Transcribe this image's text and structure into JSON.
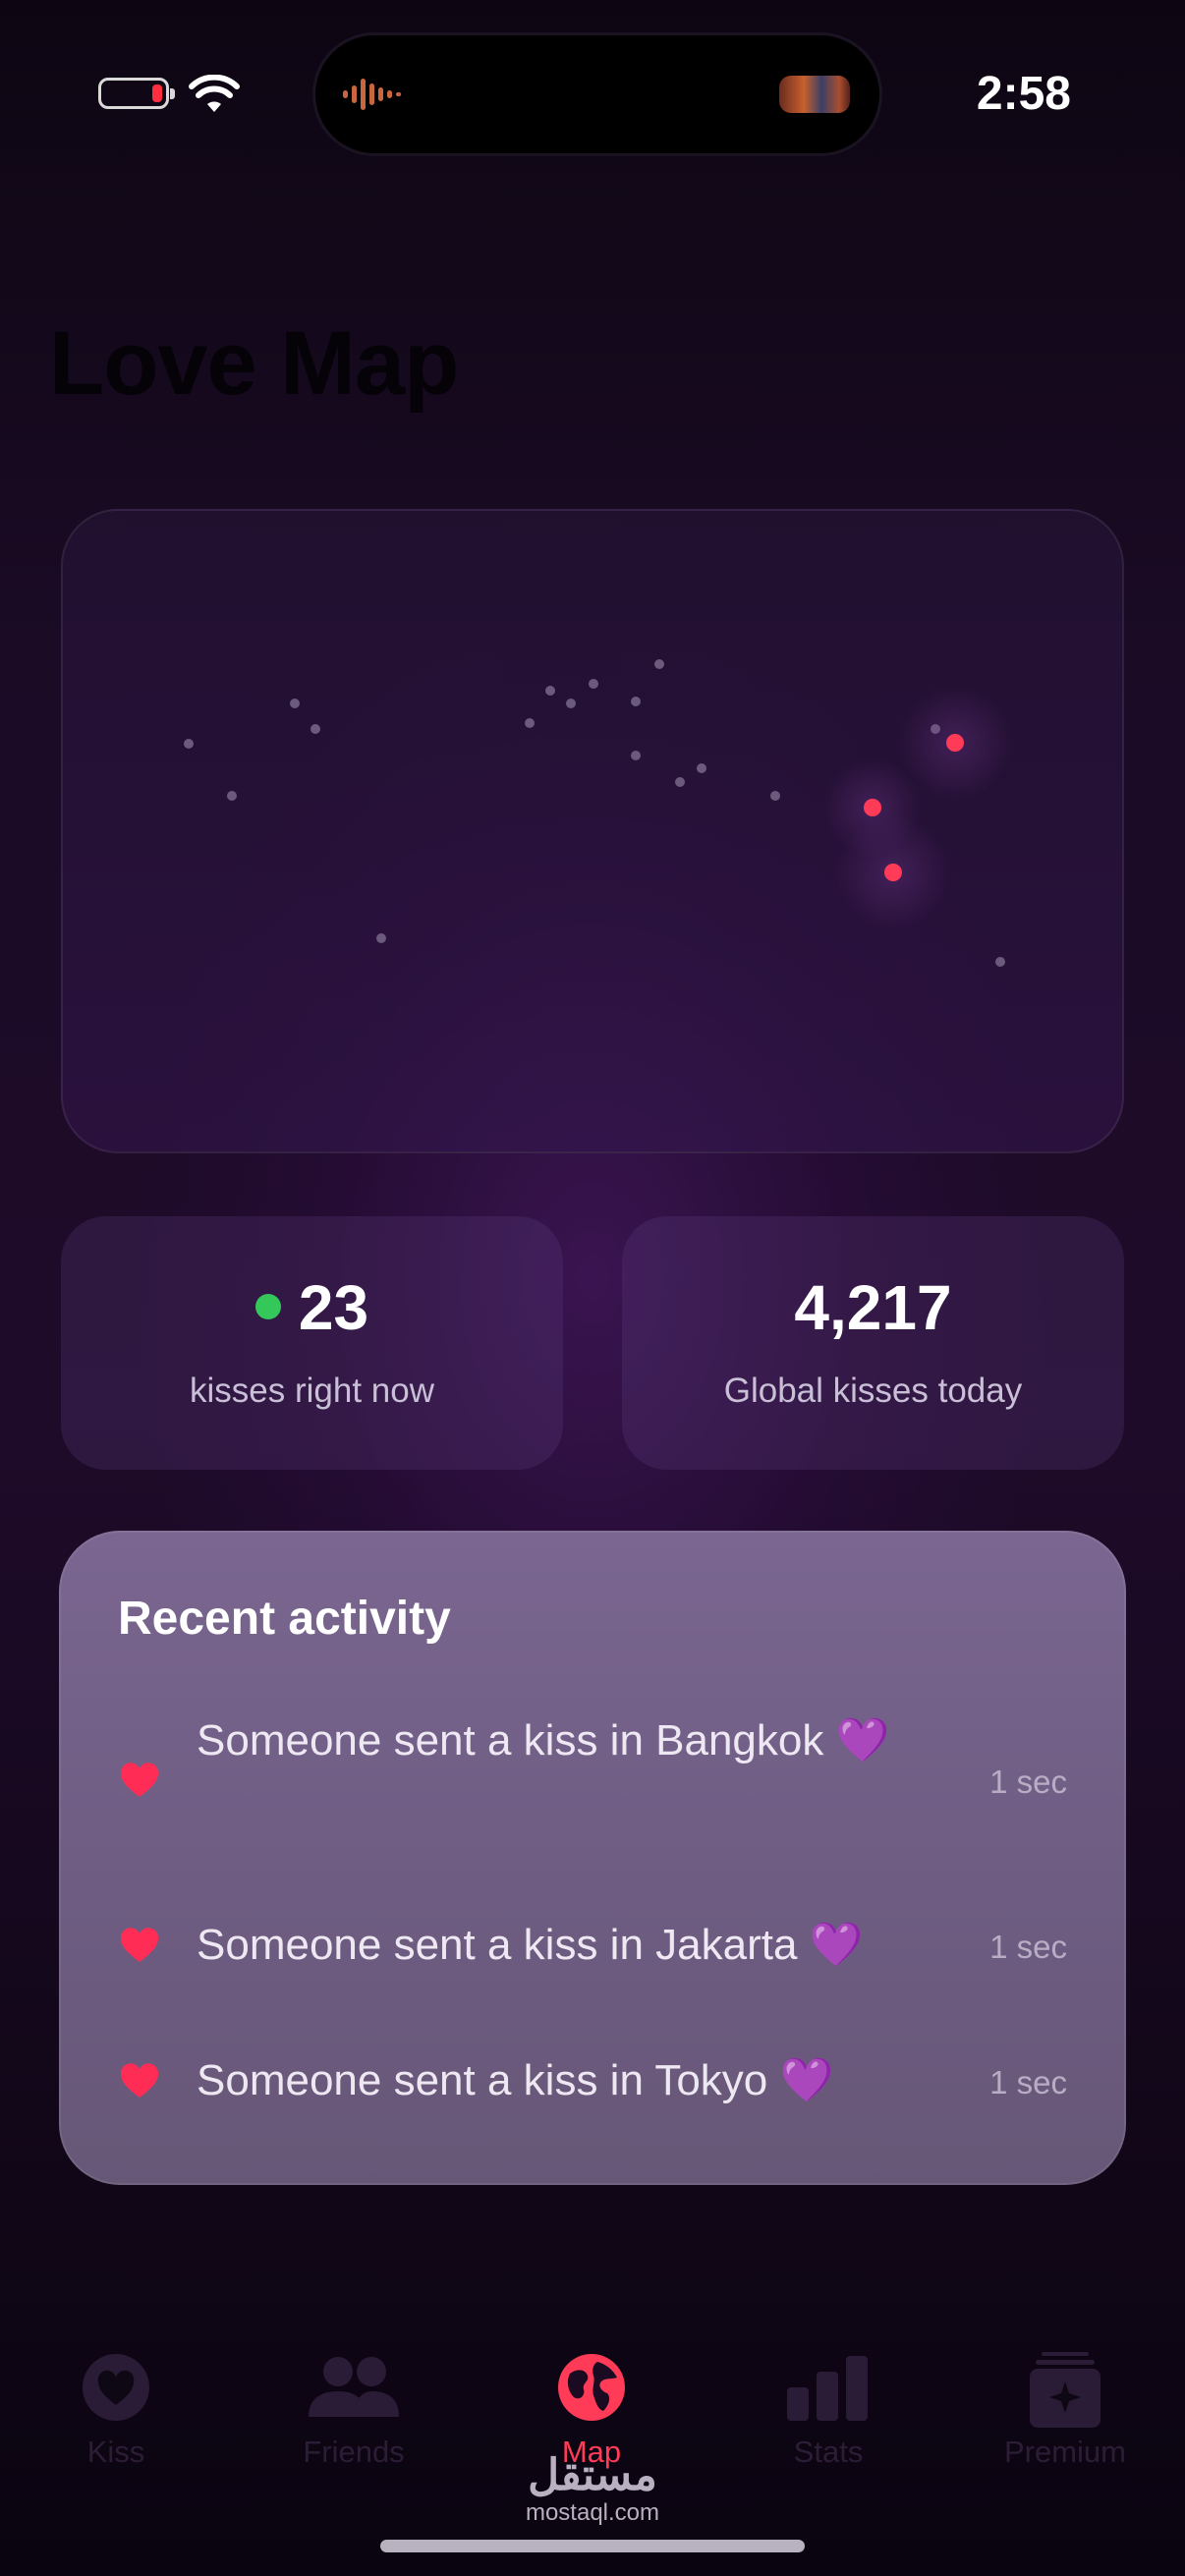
{
  "status_bar": {
    "time": "2:58",
    "battery_icon": "battery-low-icon",
    "wifi_icon": "wifi-icon"
  },
  "page": {
    "title": "Love Map"
  },
  "stats": {
    "live": {
      "value": "23",
      "label": "kisses right now",
      "indicator_color": "#34c759"
    },
    "global": {
      "value": "4,217",
      "label": "Global kisses today"
    }
  },
  "recent_activity": {
    "title": "Recent activity",
    "items": [
      {
        "text": "Someone sent a kiss in Bangkok 💜",
        "time": "1 sec"
      },
      {
        "text": "Someone sent a kiss in Jakarta 💜",
        "time": "1 sec"
      },
      {
        "text": "Someone sent a kiss in Tokyo 💜",
        "time": "1 sec"
      }
    ]
  },
  "tabs": [
    {
      "label": "Kiss",
      "icon": "heart-icon",
      "active": false
    },
    {
      "label": "Friends",
      "icon": "people-icon",
      "active": false
    },
    {
      "label": "Map",
      "icon": "globe-icon",
      "active": true
    },
    {
      "label": "Stats",
      "icon": "bar-chart-icon",
      "active": false
    },
    {
      "label": "Premium",
      "icon": "premium-sparkle-icon",
      "active": false
    }
  ],
  "watermark": {
    "arabic": "مستقل",
    "latin": "mostaql.com"
  },
  "colors": {
    "accent": "#ff3b57",
    "kiss_marker": "#ff3b57",
    "map_dot": "#6a5a7a"
  }
}
